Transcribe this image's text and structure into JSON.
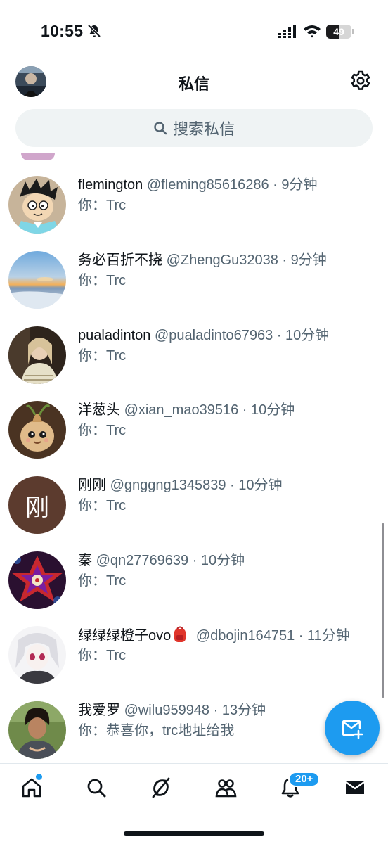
{
  "status_bar": {
    "time": "10:55",
    "battery": "49",
    "battery_level": 0.49
  },
  "header": {
    "title": "私信"
  },
  "search": {
    "placeholder": "搜索私信"
  },
  "conversations": [
    {
      "name": "flemington",
      "meta": "@fleming85616286 · 9分钟",
      "preview": "你：Trc"
    },
    {
      "name": "务必百折不挠",
      "meta": "@ZhengGu32038 · 9分钟",
      "preview": "你：Trc"
    },
    {
      "name": "pualadinton",
      "meta": "@pualadinto67963 · 10分钟",
      "preview": "你：Trc"
    },
    {
      "name": "洋葱头",
      "meta": "@xian_mao39516 · 10分钟",
      "preview": "你：Trc"
    },
    {
      "name": "刚刚",
      "meta": "@gnggng1345839 · 10分钟",
      "preview": "你：Trc",
      "avatar_letter": "刚"
    },
    {
      "name": "秦",
      "meta": "@qn27769639 · 10分钟",
      "preview": "你：Trc"
    },
    {
      "name": "绿绿绿橙子ovo",
      "meta": "@dbojin164751 · 11分钟",
      "preview": "你：Trc",
      "name_emoji": "backpack-icon"
    },
    {
      "name": "我爱罗",
      "meta": "@wilu959948 · 13分钟",
      "preview": "你：恭喜你，trc地址给我"
    }
  ],
  "bottom_nav": {
    "notifications_badge": "20+"
  },
  "colors": {
    "accent": "#1d9bf0",
    "text": "#0f1419",
    "secondary": "#536471"
  }
}
